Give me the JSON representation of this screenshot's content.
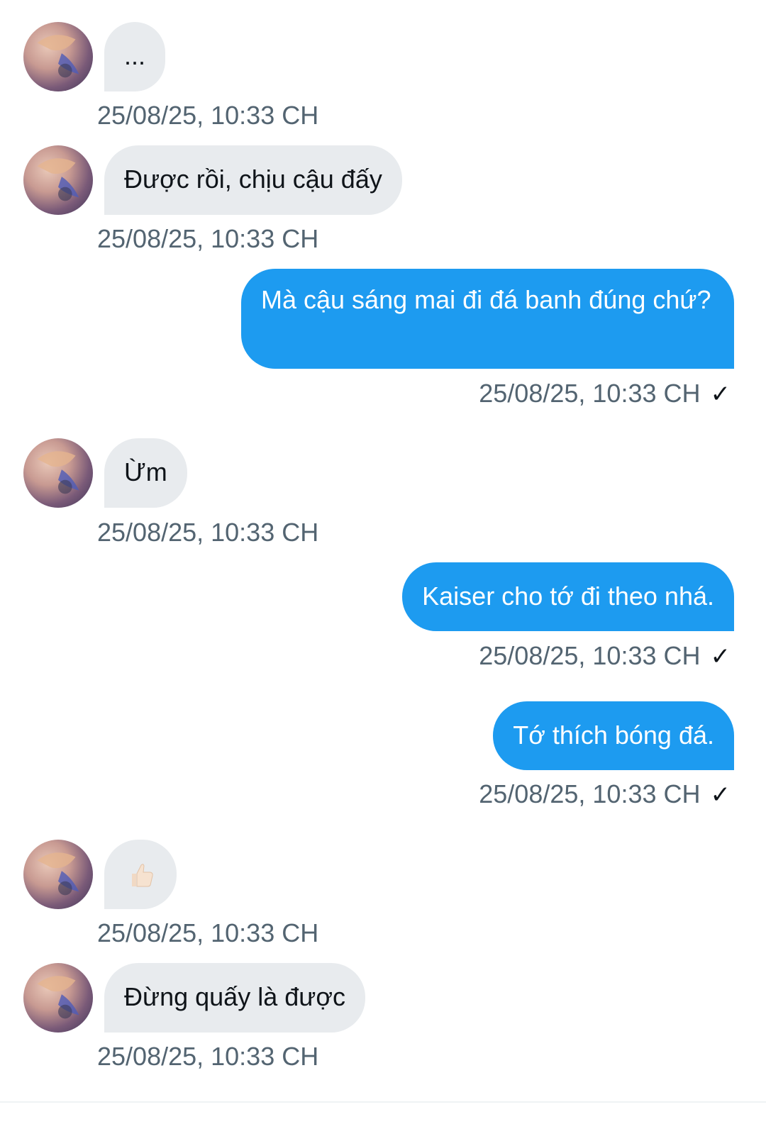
{
  "messages": [
    {
      "direction": "in",
      "text": "...",
      "timestamp": "25/08/25, 10:33 CH"
    },
    {
      "direction": "in",
      "text": "Được rồi, chịu cậu đấy",
      "timestamp": "25/08/25, 10:33 CH"
    },
    {
      "direction": "out",
      "text": "Mà cậu sáng mai đi đá banh đúng chứ?",
      "timestamp": "25/08/25, 10:33 CH",
      "status_icon": "check-icon"
    },
    {
      "direction": "in",
      "text": "Ừm",
      "timestamp": "25/08/25, 10:33 CH"
    },
    {
      "direction": "out",
      "text": "Kaiser cho tớ đi theo nhá.",
      "timestamp": "25/08/25, 10:33 CH",
      "status_icon": "check-icon"
    },
    {
      "direction": "out",
      "text": "Tớ thích bóng đá.",
      "timestamp": "25/08/25, 10:33 CH",
      "status_icon": "check-icon"
    },
    {
      "direction": "in",
      "text": "",
      "icon": "thumbs-up-emoji",
      "timestamp": "25/08/25, 10:33 CH"
    },
    {
      "direction": "in",
      "text": "Đừng quấy là được",
      "timestamp": "25/08/25, 10:33 CH"
    }
  ],
  "check_glyph": "✓",
  "colors": {
    "incoming_bubble": "#e8ebee",
    "outgoing_bubble": "#1d9bf0",
    "timestamp": "#536471"
  }
}
